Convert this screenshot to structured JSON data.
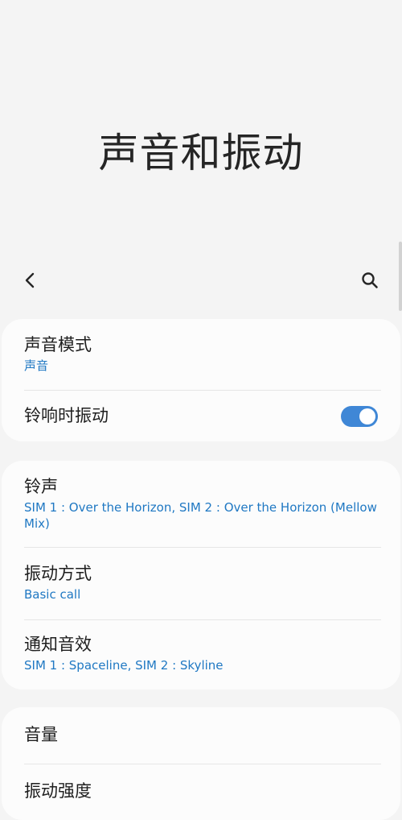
{
  "header": {
    "title": "声音和振动",
    "back_icon": "chevron-left-icon",
    "search_icon": "search-icon"
  },
  "sections": {
    "sound_mode": {
      "title": "声音模式",
      "value": "声音"
    },
    "vibrate_on_ring": {
      "title": "铃响时振动",
      "enabled": true
    },
    "ringtone": {
      "title": "铃声",
      "value": "SIM 1 : Over the Horizon, SIM 2 : Over the Horizon (Mellow Mix)"
    },
    "vibration_pattern": {
      "title": "振动方式",
      "value": "Basic call"
    },
    "notification_sound": {
      "title": "通知音效",
      "value": "SIM 1 : Spaceline, SIM 2 : Skyline"
    },
    "volume": {
      "title": "音量"
    },
    "vibration_intensity": {
      "title": "振动强度"
    }
  },
  "colors": {
    "background": "#f4f4f4",
    "card": "#fcfcfc",
    "accent": "#1f78c3",
    "toggle_on": "#3f87d6"
  }
}
